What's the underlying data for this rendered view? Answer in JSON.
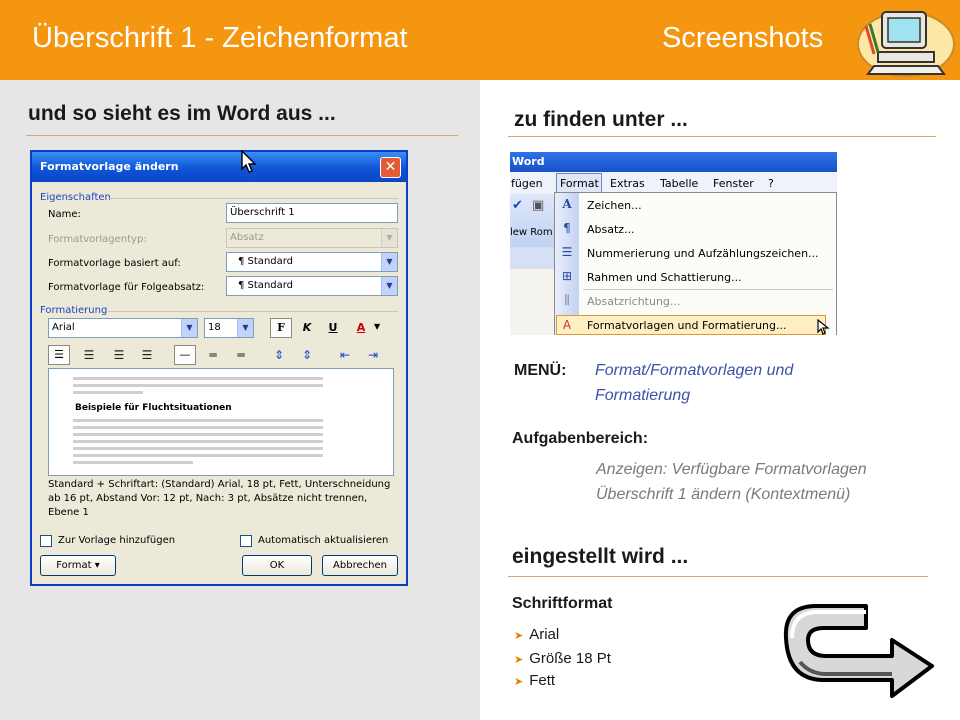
{
  "header": {
    "title": "Überschrift 1 - Zeichenformat",
    "right_label": "Screenshots"
  },
  "left": {
    "heading": "und so sieht es im Word aus ..."
  },
  "dialog": {
    "title": "Formatvorlage ändern",
    "close_glyph": "✕",
    "group_properties": "Eigenschaften",
    "label_name": "Name:",
    "value_name": "Überschrift 1",
    "label_type": "Formatvorlagentyp:",
    "value_type": "Absatz",
    "label_based_on": "Formatvorlage basiert auf:",
    "value_based_on": "¶ Standard",
    "label_following": "Formatvorlage für Folgeabsatz:",
    "value_following": "¶ Standard",
    "group_formatting": "Formatierung",
    "font_value": "Arial",
    "size_value": "18",
    "bold_glyph": "F",
    "italic_glyph": "K",
    "underline_glyph": "U",
    "fontcolor_glyph": "A",
    "preview_heading": "Beispiele für Fluchtsituationen",
    "description": "Standard + Schriftart: (Standard) Arial, 18 pt, Fett, Unterschneidung ab 16 pt, Abstand Vor: 12 pt, Nach: 3 pt, Absätze nicht trennen, Ebene 1",
    "checkbox_add_template": "Zur Vorlage hinzufügen",
    "checkbox_auto_update": "Automatisch aktualisieren",
    "button_format": "Format ▾",
    "button_ok": "OK",
    "button_cancel": "Abbrechen"
  },
  "menu_shot": {
    "title": "Word",
    "menubar": [
      "fügen",
      "Format",
      "Extras",
      "Tabelle",
      "Fenster",
      "?"
    ],
    "left_fragment": "lew Rom",
    "items": [
      "Zeichen...",
      "Absatz...",
      "Nummerierung und Aufzählungszeichen...",
      "Rahmen und Schattierung...",
      "Absatzrichtung...",
      "Formatvorlagen und Formatierung..."
    ]
  },
  "right": {
    "heading_find": "zu finden unter ...",
    "menu_label": "MENÜ:",
    "menu_path_1": "Format/Formatvorlagen und",
    "menu_path_2": "Formatierung",
    "task_label": "Aufgabenbereich:",
    "task_line_1": "Anzeigen: Verfügbare Formatvorlagen",
    "task_line_2": "Überschrift 1 ändern (Kontextmenü)",
    "heading_set": "eingestellt wird ...",
    "font_format_label": "Schriftformat",
    "bullets": [
      "Arial",
      "Größe 18 Pt",
      "Fett"
    ]
  },
  "colors": {
    "header_orange": "#f4960f",
    "rule": "#d9a66a",
    "xp_blue": "#0a46c4",
    "italic_blue": "#3a53a8"
  }
}
